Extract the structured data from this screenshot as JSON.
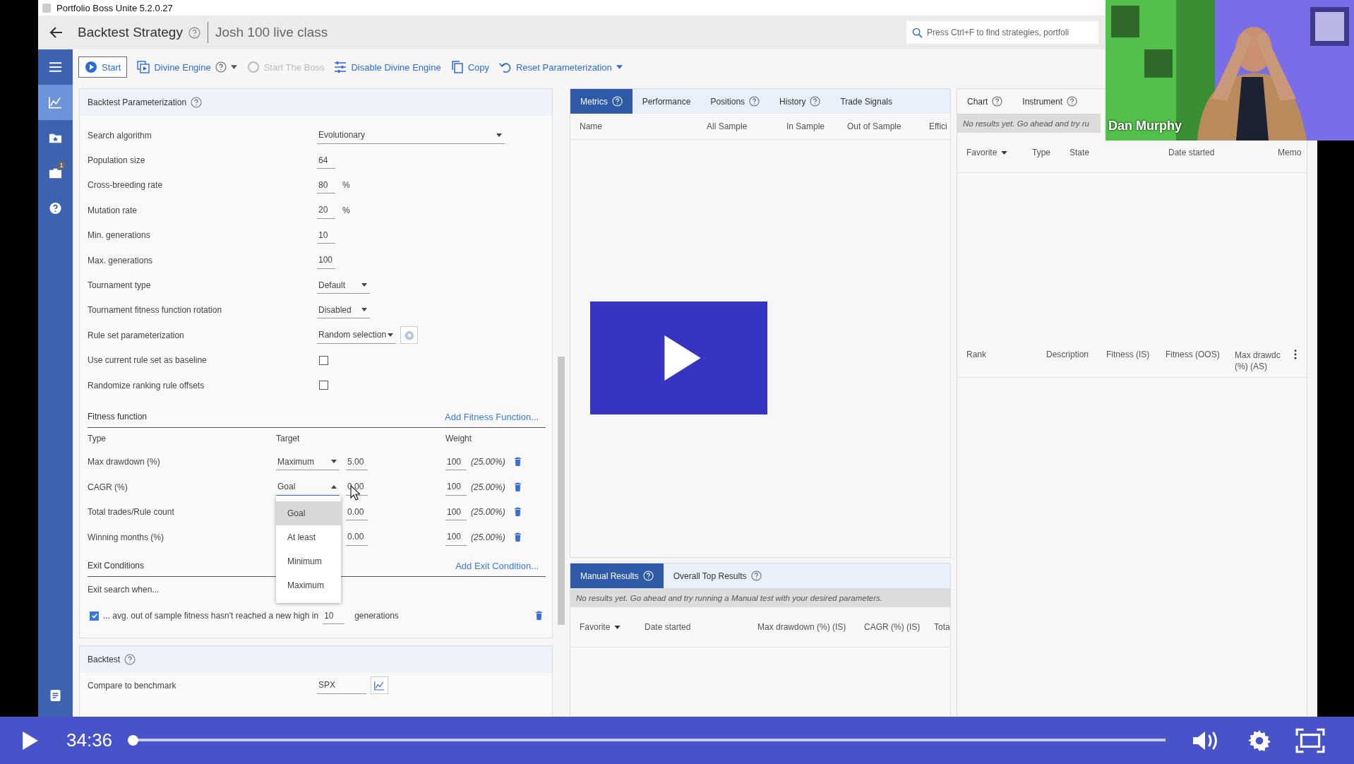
{
  "window": {
    "title": "Portfolio Boss Unite 5.2.0.27"
  },
  "header": {
    "title": "Backtest Strategy",
    "subtitle": "Josh 100 live class",
    "search": {
      "placeholder": "Press Ctrl+F to find strategies, portfoli"
    }
  },
  "nav": [
    {
      "kind": "menu",
      "selected": false
    },
    {
      "kind": "chart",
      "selected": true
    },
    {
      "kind": "favorites",
      "selected": false
    },
    {
      "kind": "briefcase",
      "selected": false,
      "badge": "1"
    },
    {
      "kind": "help",
      "selected": false
    }
  ],
  "nav_bottom": [
    {
      "kind": "notes",
      "selected": false
    }
  ],
  "toolbar": [
    {
      "kind": "start",
      "label": "Start",
      "help": false,
      "dropdown": false,
      "disabled": false
    },
    {
      "kind": "engine",
      "label": "Divine Engine",
      "help": true,
      "dropdown": true,
      "disabled": false
    },
    {
      "kind": "boss",
      "label": "Start The Boss",
      "help": false,
      "dropdown": false,
      "disabled": true
    },
    {
      "kind": "sliders",
      "label": "Disable Divine Engine",
      "help": false,
      "dropdown": false,
      "disabled": false
    },
    {
      "kind": "copy",
      "label": "Copy",
      "help": false,
      "dropdown": false,
      "disabled": false
    },
    {
      "kind": "reset",
      "label": "Reset Parameterization",
      "help": false,
      "dropdown": true,
      "disabled": false
    }
  ],
  "parameterization": {
    "title": "Backtest Parameterization",
    "fields": [
      {
        "kind": "select-wide",
        "label": "Search algorithm",
        "value": "Evolutionary"
      },
      {
        "kind": "number",
        "label": "Population size",
        "value": "64"
      },
      {
        "kind": "number",
        "label": "Cross-breeding rate",
        "value": "80",
        "unit": "%"
      },
      {
        "kind": "number",
        "label": "Mutation rate",
        "value": "20",
        "unit": "%"
      },
      {
        "kind": "number",
        "label": "Min. generations",
        "value": "10"
      },
      {
        "kind": "number",
        "label": "Max. generations",
        "value": "100"
      },
      {
        "kind": "select",
        "label": "Tournament type",
        "value": "Default"
      },
      {
        "kind": "select",
        "label": "Tournament fitness function rotation",
        "value": "Disabled"
      },
      {
        "kind": "select-gear",
        "label": "Rule set parameterization",
        "value": "Random selection"
      },
      {
        "kind": "checkbox",
        "label": "Use current rule set as baseline",
        "checked": false
      },
      {
        "kind": "checkbox",
        "label": "Randomize ranking rule offsets",
        "checked": false
      }
    ]
  },
  "fitness": {
    "title": "Fitness function",
    "add_link": "Add Fitness Function...",
    "columns": [
      "Type",
      "Target",
      "Weight"
    ],
    "rows": [
      {
        "type": "Max drawdown (%)",
        "target": "Maximum",
        "open": false,
        "value": "5.00",
        "weight": "100",
        "share": "(25.00%)"
      },
      {
        "type": "CAGR (%)",
        "target": "Goal",
        "open": true,
        "value": "0.00",
        "weight": "100",
        "share": "(25.00%)"
      },
      {
        "type": "Total trades/Rule count",
        "value": "0.00",
        "weight": "100",
        "share": "(25.00%)"
      },
      {
        "type": "Winning months (%)",
        "value": "0.00",
        "weight": "100",
        "share": "(25.00%)"
      }
    ],
    "target_menu": [
      {
        "label": "Goal",
        "selected": true
      },
      {
        "label": "At least",
        "selected": false
      },
      {
        "label": "Minimum",
        "selected": false
      },
      {
        "label": "Maximum",
        "selected": false
      }
    ]
  },
  "exit": {
    "title": "Exit Conditions",
    "add_link": "Add Exit Condition...",
    "intro": "Exit search when...",
    "conditions": [
      {
        "checked": true,
        "text": "... avg. out of sample fitness hasn't reached a new high in",
        "value": "10",
        "unit": "generations"
      }
    ]
  },
  "backtest": {
    "title": "Backtest",
    "fields": [
      {
        "label": "Compare to benchmark",
        "value": "SPX"
      }
    ]
  },
  "metrics": {
    "tabs": [
      {
        "label": "Metrics",
        "help": true,
        "selected": true
      },
      {
        "label": "Performance",
        "help": false,
        "selected": false
      },
      {
        "label": "Positions",
        "help": true,
        "selected": false
      },
      {
        "label": "History",
        "help": true,
        "selected": false
      },
      {
        "label": "Trade Signals",
        "help": false,
        "selected": false
      }
    ],
    "columns": [
      "Name",
      "All Sample",
      "In Sample",
      "Out of Sample",
      "Effici"
    ]
  },
  "results": {
    "tabs": [
      {
        "label": "Manual Results",
        "help": true,
        "selected": true
      },
      {
        "label": "Overall Top Results",
        "help": true,
        "selected": false
      }
    ],
    "message": "No results yet. Go ahead and try running a Manual test with your desired parameters.",
    "columns": [
      {
        "label": "Favorite",
        "menu": true
      },
      {
        "label": "Date started",
        "menu": false
      },
      {
        "label": "Max drawdown (%) (IS)",
        "menu": false
      },
      {
        "label": "CAGR (%) (IS)",
        "menu": false
      },
      {
        "label": "Tota",
        "menu": false
      }
    ]
  },
  "side": {
    "tabs": [
      {
        "label": "Chart",
        "help": true
      },
      {
        "label": "Instrument",
        "help": true
      }
    ],
    "message": "No results yet. Go ahead and try ru",
    "columns": [
      {
        "label": "Favorite",
        "menu": true
      },
      {
        "label": "Type",
        "menu": false
      },
      {
        "label": "State",
        "menu": false
      },
      {
        "label": "Date started",
        "menu": false
      },
      {
        "label": "Memo",
        "menu": false
      }
    ],
    "rank_columns": [
      "Rank",
      "Description",
      "Fitness (IS)",
      "Fitness (OOS)",
      "Max drawdc (%) (AS)"
    ]
  },
  "webcam": {
    "name": "Dan Murphy"
  },
  "player": {
    "time": "34:36",
    "level": 0
  }
}
